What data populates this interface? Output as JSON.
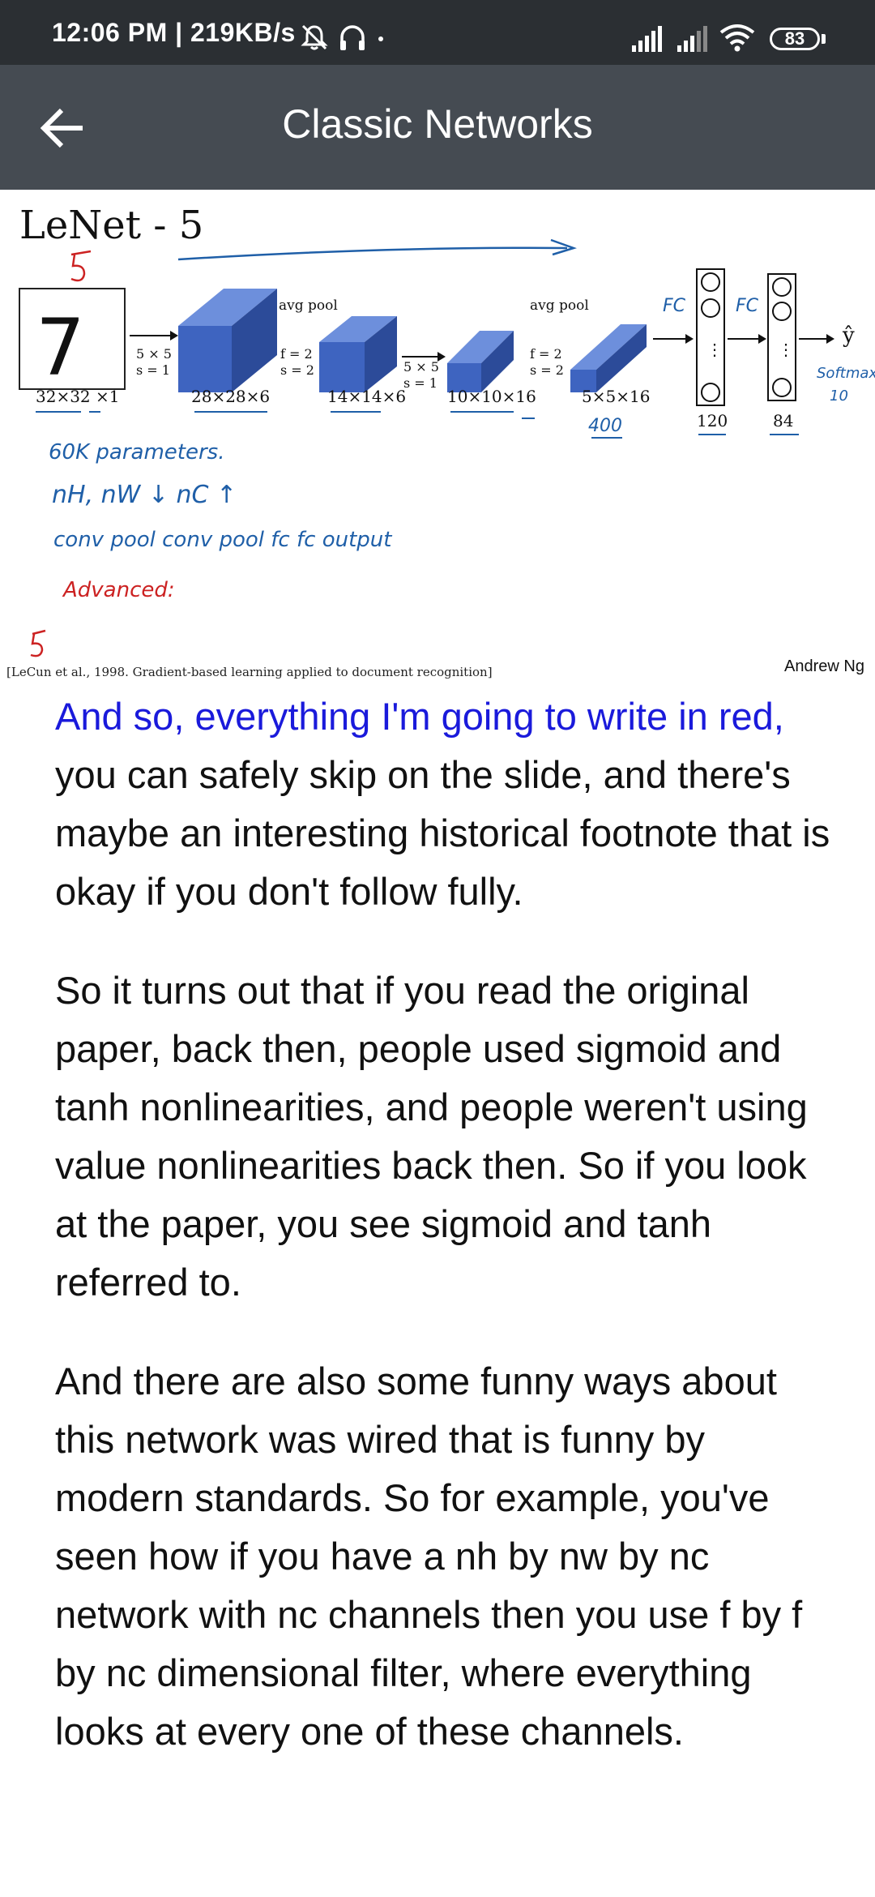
{
  "status_bar": {
    "time": "12:06 PM | 219KB/s",
    "battery": "83",
    "icons": [
      "mute-bell-icon",
      "headphones-icon",
      "signal-icon",
      "signal-icon",
      "wifi-icon",
      "battery-icon"
    ]
  },
  "app_bar": {
    "title": "Classic Networks",
    "back_icon": "arrow-left-icon"
  },
  "slide": {
    "title": "LeNet - 5",
    "input_digit": "7",
    "input_size": "32×32 ×1",
    "layers": [
      {
        "op": "5 × 5",
        "stride": "s = 1",
        "size": "28×28×6"
      },
      {
        "op_title": "avg pool",
        "op": "f = 2",
        "stride": "s = 2",
        "size": "14×14×6"
      },
      {
        "op": "5 × 5",
        "stride": "s = 1",
        "size": "10×10×16"
      },
      {
        "op_title": "avg pool",
        "op": "f = 2",
        "stride": "s = 2",
        "size": "5×5×16"
      }
    ],
    "fc1": "120",
    "fc2": "84",
    "output": "ŷ",
    "handwritten": {
      "fc1_label": "FC",
      "fc2_label": "FC",
      "count_400": "400",
      "softmax": "Softmax",
      "ten": "10",
      "params": "60K parameters.",
      "dims": "nH, nW ↓   nC ↑",
      "sequence": "conv  pool  conv  pool  fc  fc  output",
      "advanced": "Advanced:"
    },
    "citation": "[LeCun et al., 1998. Gradient-based learning applied to document recognition]",
    "author": "Andrew Ng"
  },
  "transcript": {
    "p1_highlight": "And so, everything I'm going to write in red,",
    "p1_rest": " you can safely skip on the slide, and there's maybe an interesting historical footnote that is okay if you don't follow fully.",
    "p2": "So it turns out that if you read the original paper, back then, people used sigmoid and tanh nonlinearities, and people weren't using value nonlinearities back then. So if you look at the paper, you see sigmoid and tanh referred to.",
    "p3": "And there are also some funny ways about this network was wired that is funny by modern standards. So for example, you've seen how if you have a nh by nw by nc network with nc channels then you use f by f by nc dimensional filter, where everything looks at every one of these channels."
  },
  "colors": {
    "status_bar_bg": "#2b2f33",
    "app_bar_bg": "#454b52",
    "highlight_text": "#1a1adb",
    "ink_blue": "#1f5fa8",
    "ink_red": "#cc2222",
    "block_front": "#3e64c0",
    "block_top": "#6d8fdc",
    "block_side": "#2c4b99"
  }
}
